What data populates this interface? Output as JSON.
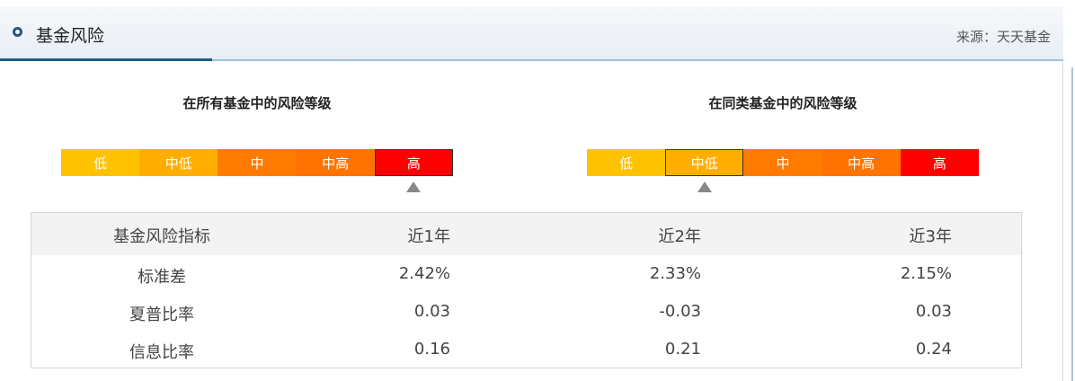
{
  "header": {
    "title": "基金风险",
    "source": "来源：天天基金"
  },
  "ratings": [
    {
      "title": "在所有基金中的风险等级",
      "levels": [
        "低",
        "中低",
        "中",
        "中高",
        "高"
      ],
      "selected": "高"
    },
    {
      "title": "在同类基金中的风险等级",
      "levels": [
        "低",
        "中低",
        "中",
        "中高",
        "高"
      ],
      "selected": "中低"
    }
  ],
  "level_colors": [
    "#ffc200",
    "#ffae00",
    "#ff7b00",
    "#ff7400",
    "#ff0000"
  ],
  "table": {
    "headers": [
      "基金风险指标",
      "近1年",
      "近2年",
      "近3年"
    ],
    "rows": [
      {
        "label": "标准差",
        "values": [
          "2.42%",
          "2.33%",
          "2.15%"
        ]
      },
      {
        "label": "夏普比率",
        "values": [
          "0.03",
          "-0.03",
          "0.03"
        ]
      },
      {
        "label": "信息比率",
        "values": [
          "0.16",
          "0.21",
          "0.24"
        ]
      }
    ]
  },
  "icons": {
    "title_icon": "circle-bullet-icon",
    "marker_icon": "triangle-up-icon"
  }
}
